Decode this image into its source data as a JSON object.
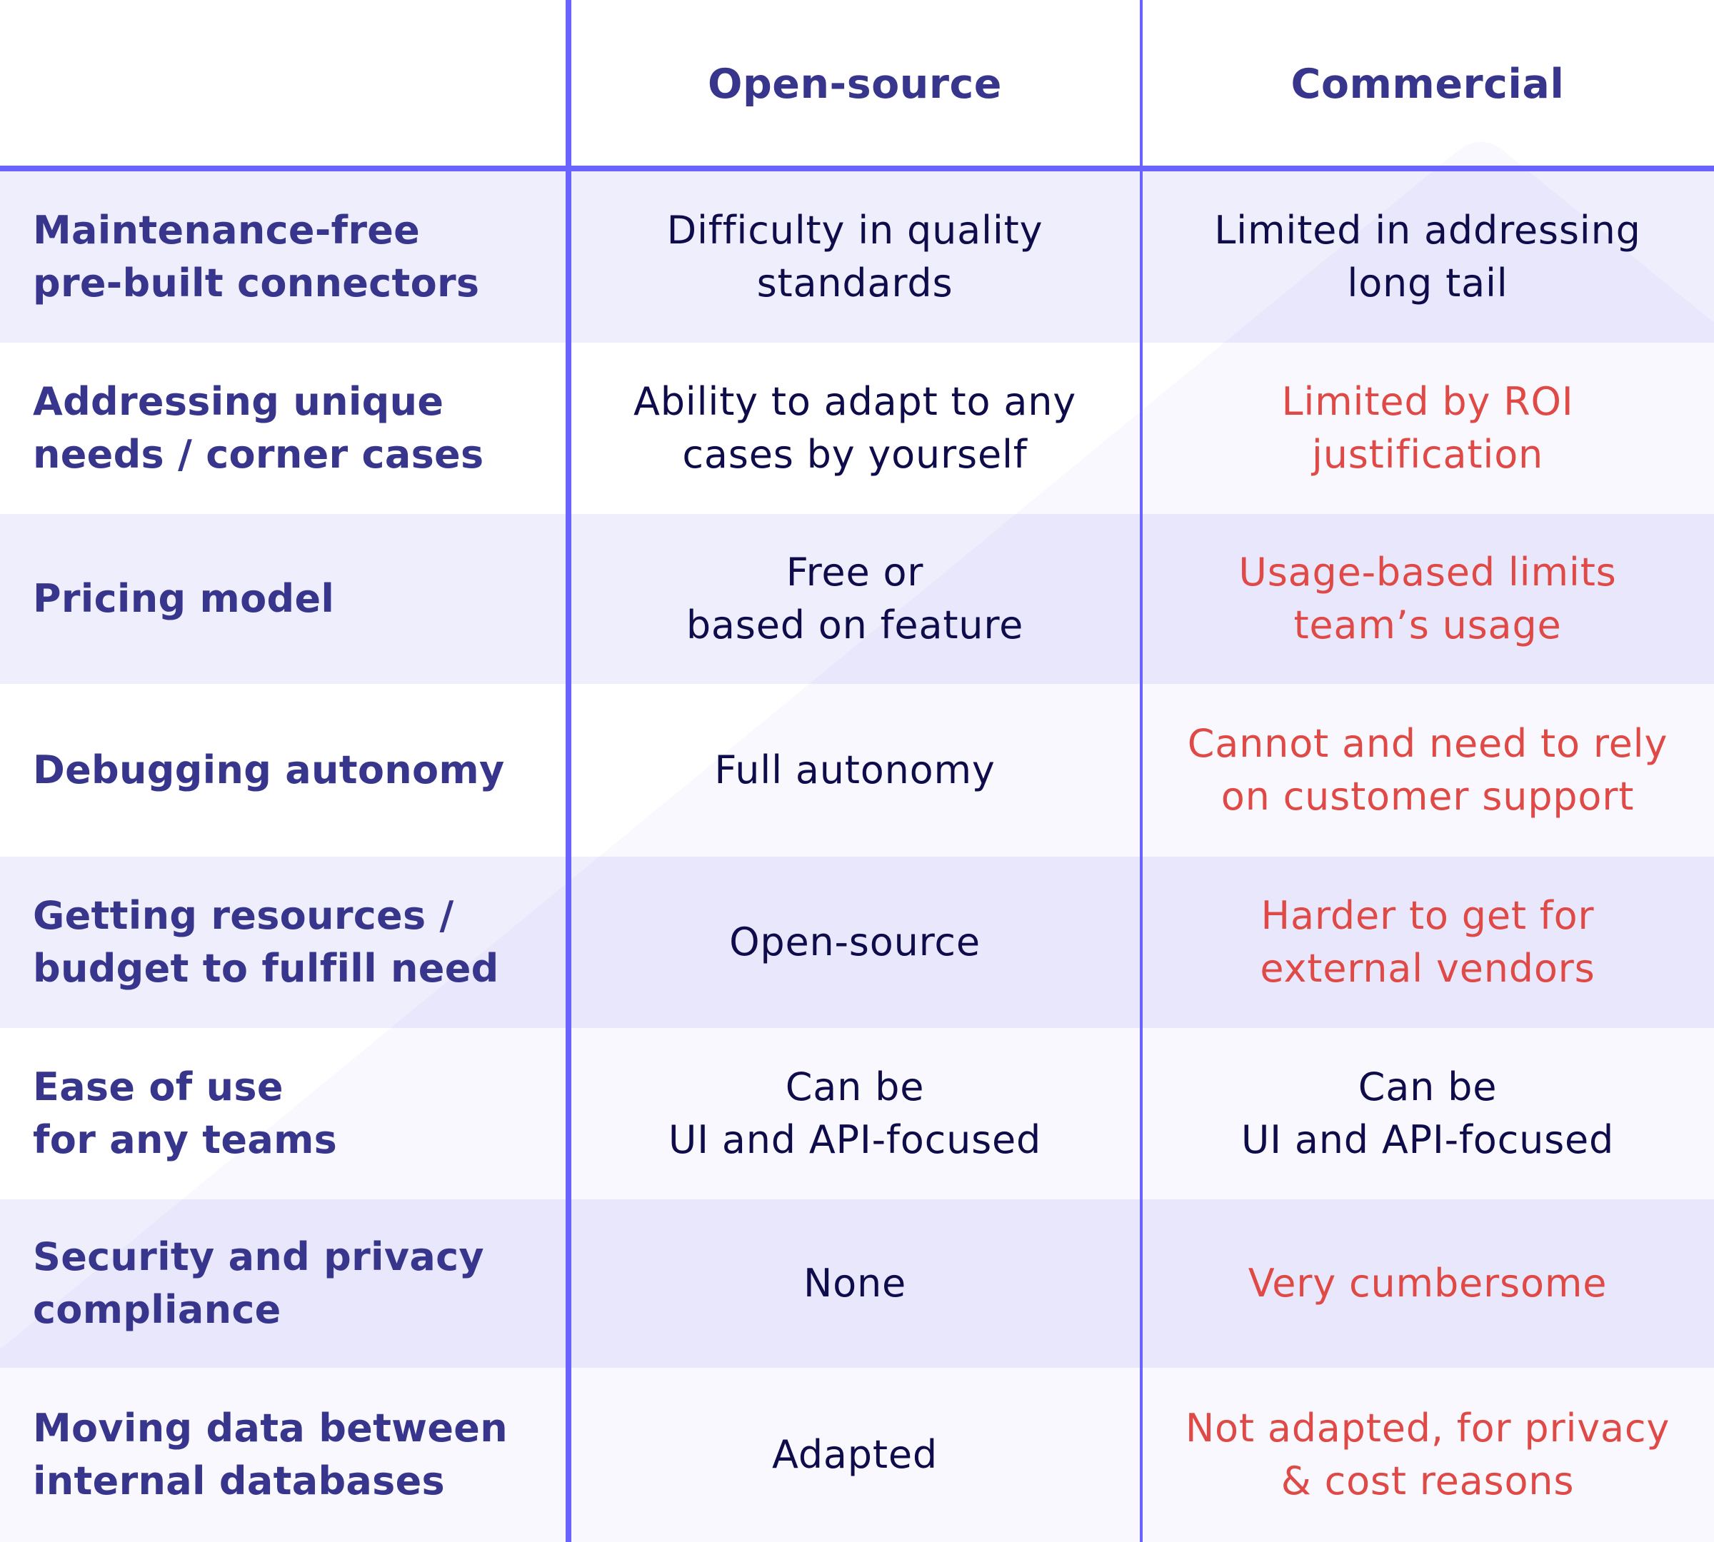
{
  "header": {
    "corner_label": "",
    "columns": [
      "Open-source",
      "Commercial"
    ]
  },
  "colors": {
    "accent_line": "#6b63ff",
    "heading_text": "#37358c",
    "neutral_text": "#0e0c4a",
    "negative_text": "#e04a46",
    "band_lavender": "#eeeefc",
    "band_white": "#ffffff"
  },
  "rows": [
    {
      "feature": "Maintenance-free\npre-built connectors",
      "open_source": {
        "text": "Difficulty in quality\nstandards",
        "tone": "neutral"
      },
      "commercial": {
        "text": "Limited in addressing\nlong tail",
        "tone": "neutral"
      }
    },
    {
      "feature": "Addressing unique\nneeds / corner cases",
      "open_source": {
        "text": "Ability to adapt to any\ncases by yourself",
        "tone": "neutral"
      },
      "commercial": {
        "text": "Limited by ROI\njustification",
        "tone": "negative"
      }
    },
    {
      "feature": "Pricing model",
      "open_source": {
        "text": "Free or\nbased on feature",
        "tone": "neutral"
      },
      "commercial": {
        "text": "Usage-based limits\nteam’s usage",
        "tone": "negative"
      }
    },
    {
      "feature": "Debugging autonomy",
      "open_source": {
        "text": "Full autonomy",
        "tone": "neutral"
      },
      "commercial": {
        "text": "Cannot and need to rely\non customer support",
        "tone": "negative"
      }
    },
    {
      "feature": "Getting resources /\nbudget to fulfill need",
      "open_source": {
        "text": "Open-source",
        "tone": "neutral"
      },
      "commercial": {
        "text": "Harder to get for\nexternal vendors",
        "tone": "negative"
      }
    },
    {
      "feature": "Ease of use\nfor any teams",
      "open_source": {
        "text": "Can be\nUI and API-focused",
        "tone": "neutral"
      },
      "commercial": {
        "text": "Can be\nUI and API-focused",
        "tone": "neutral"
      }
    },
    {
      "feature": "Security and privacy\ncompliance",
      "open_source": {
        "text": "None",
        "tone": "neutral"
      },
      "commercial": {
        "text": "Very cumbersome",
        "tone": "negative"
      }
    },
    {
      "feature": "Moving data between\ninternal databases",
      "open_source": {
        "text": "Adapted",
        "tone": "neutral"
      },
      "commercial": {
        "text": "Not adapted, for privacy\n& cost reasons",
        "tone": "negative"
      }
    }
  ]
}
